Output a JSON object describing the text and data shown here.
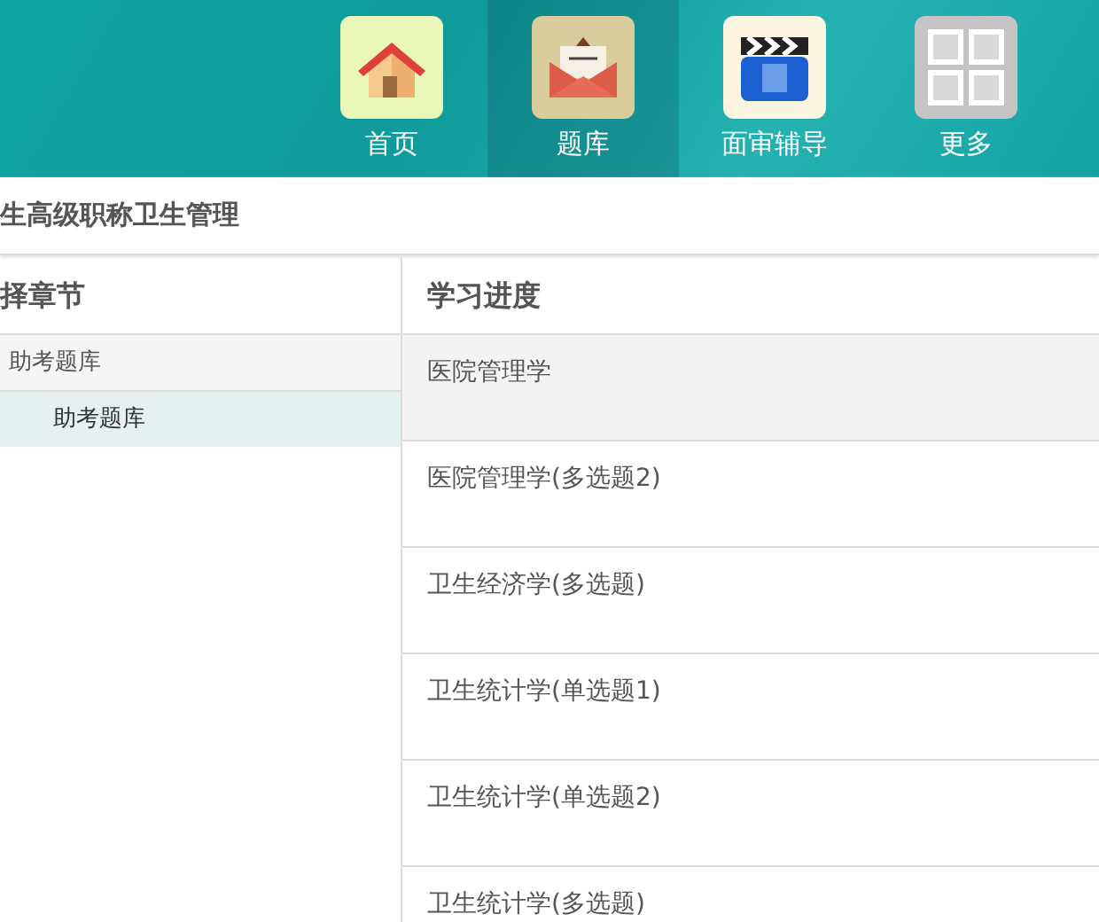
{
  "nav": [
    {
      "label": "首页",
      "kind": "home",
      "selected": false
    },
    {
      "label": "题库",
      "kind": "bank",
      "selected": true
    },
    {
      "label": "面审辅导",
      "kind": "video",
      "selected": false
    },
    {
      "label": "更多",
      "kind": "more",
      "selected": false
    }
  ],
  "page_title": "生高级职称卫生管理",
  "chapters": {
    "heading": "择章节",
    "tree": [
      {
        "label": "助考题库",
        "selected": false,
        "children": [
          {
            "label": "助考题库",
            "selected": true
          }
        ]
      }
    ]
  },
  "progress": {
    "heading": "学习进度",
    "rows": [
      {
        "label": "医院管理学",
        "selected": true
      },
      {
        "label": "医院管理学(多选题2)",
        "selected": false
      },
      {
        "label": "卫生经济学(多选题)",
        "selected": false
      },
      {
        "label": "卫生统计学(单选题1)",
        "selected": false
      },
      {
        "label": "卫生统计学(单选题2)",
        "selected": false
      },
      {
        "label": "卫生统计学(多选题)",
        "selected": false
      }
    ]
  }
}
